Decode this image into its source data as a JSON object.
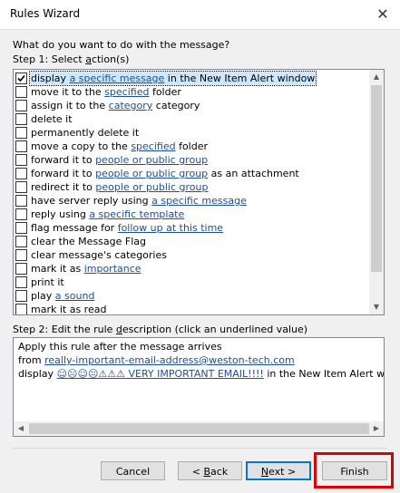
{
  "window": {
    "title": "Rules Wizard",
    "close_glyph": "✕"
  },
  "question": "What do you want to do with the message?",
  "step1": {
    "label_pre": "Step 1: Select ",
    "label_ul": "a",
    "label_post": "ction(s)"
  },
  "actions": [
    {
      "checked": true,
      "selected": true,
      "pre": "display ",
      "link": "a specific message",
      "post": " in the New Item Alert window"
    },
    {
      "checked": false,
      "pre": "move it to the ",
      "link": "specified",
      "post": " folder"
    },
    {
      "checked": false,
      "pre": "assign it to the ",
      "link": "category",
      "post": " category"
    },
    {
      "checked": false,
      "pre": "delete it",
      "link": "",
      "post": ""
    },
    {
      "checked": false,
      "pre": "permanently delete it",
      "link": "",
      "post": ""
    },
    {
      "checked": false,
      "pre": "move a copy to the ",
      "link": "specified",
      "post": " folder"
    },
    {
      "checked": false,
      "pre": "forward it to ",
      "link": "people or public group",
      "post": ""
    },
    {
      "checked": false,
      "pre": "forward it to ",
      "link": "people or public group",
      "post": " as an attachment"
    },
    {
      "checked": false,
      "pre": "redirect it to ",
      "link": "people or public group",
      "post": ""
    },
    {
      "checked": false,
      "pre": "have server reply using ",
      "link": "a specific message",
      "post": ""
    },
    {
      "checked": false,
      "pre": "reply using ",
      "link": "a specific template",
      "post": ""
    },
    {
      "checked": false,
      "pre": "flag message for ",
      "link": "follow up at this time",
      "post": ""
    },
    {
      "checked": false,
      "pre": "clear the Message Flag",
      "link": "",
      "post": ""
    },
    {
      "checked": false,
      "pre": "clear message's categories",
      "link": "",
      "post": ""
    },
    {
      "checked": false,
      "pre": "mark it as ",
      "link": "importance",
      "post": ""
    },
    {
      "checked": false,
      "pre": "print it",
      "link": "",
      "post": ""
    },
    {
      "checked": false,
      "pre": "play ",
      "link": "a sound",
      "post": ""
    },
    {
      "checked": false,
      "pre": "mark it as read",
      "link": "",
      "post": ""
    }
  ],
  "step2": {
    "label_pre": "Step 2: Edit the rule ",
    "label_ul": "d",
    "label_post": "escription (click an underlined value)"
  },
  "description": {
    "line1": "Apply this rule after the message arrives",
    "line2_pre": "from ",
    "line2_link": "really-important-email-address@weston-tech.com",
    "line3_pre": "display ",
    "line3_link": "☺☹☺☹⚠⚠⚠ VERY IMPORTANT EMAIL!!!!",
    "line3_post": " in the New Item Alert windo"
  },
  "buttons": {
    "cancel": "Cancel",
    "back_pre": "< ",
    "back_ul": "B",
    "back_post": "ack",
    "next_ul": "N",
    "next_post": "ext >",
    "finish": "Finish"
  },
  "colors": {
    "link": "#1f4e9c",
    "highlight": "#e00000",
    "selection": "#cce8ff"
  }
}
